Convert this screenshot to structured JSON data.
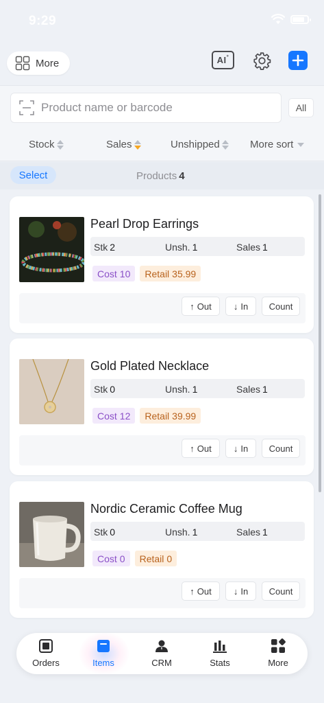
{
  "status_bar": {
    "time": "9:29"
  },
  "topbar": {
    "more_label": "More",
    "ai_label": "AI"
  },
  "search": {
    "placeholder": "Product name or barcode",
    "filter_label": "All"
  },
  "sort": {
    "stock": "Stock",
    "sales": "Sales",
    "unshipped": "Unshipped",
    "more_sort": "More sort"
  },
  "list_header": {
    "select_label": "Select",
    "products_label": "Products",
    "products_count": "4"
  },
  "labels": {
    "stk": "Stk",
    "unsh": "Unsh.",
    "sales": "Sales",
    "cost": "Cost",
    "retail": "Retail",
    "out": "Out",
    "in": "In",
    "count": "Count"
  },
  "products": [
    {
      "name": "Pearl Drop Earrings",
      "stk": "2",
      "unsh": "1",
      "sales": "1",
      "cost": "10",
      "retail": "35.99",
      "image": "beaded-bracelet-photo"
    },
    {
      "name": "Gold Plated Necklace",
      "stk": "0",
      "unsh": "1",
      "sales": "1",
      "cost": "12",
      "retail": "39.99",
      "image": "gold-necklace-photo"
    },
    {
      "name": "Nordic Ceramic Coffee Mug",
      "stk": "0",
      "unsh": "1",
      "sales": "1",
      "cost": "0",
      "retail": "0",
      "image": "ceramic-mug-photo"
    }
  ],
  "tabs": [
    {
      "label": "Orders",
      "icon": "orders-icon"
    },
    {
      "label": "Items",
      "icon": "items-icon",
      "active": true
    },
    {
      "label": "CRM",
      "icon": "crm-icon"
    },
    {
      "label": "Stats",
      "icon": "stats-icon"
    },
    {
      "label": "More",
      "icon": "more-grid-icon"
    }
  ],
  "colors": {
    "accent": "#1677ff",
    "sort_active": "#f5a623",
    "cost_text": "#8a4fc7",
    "retail_text": "#b8621d"
  }
}
